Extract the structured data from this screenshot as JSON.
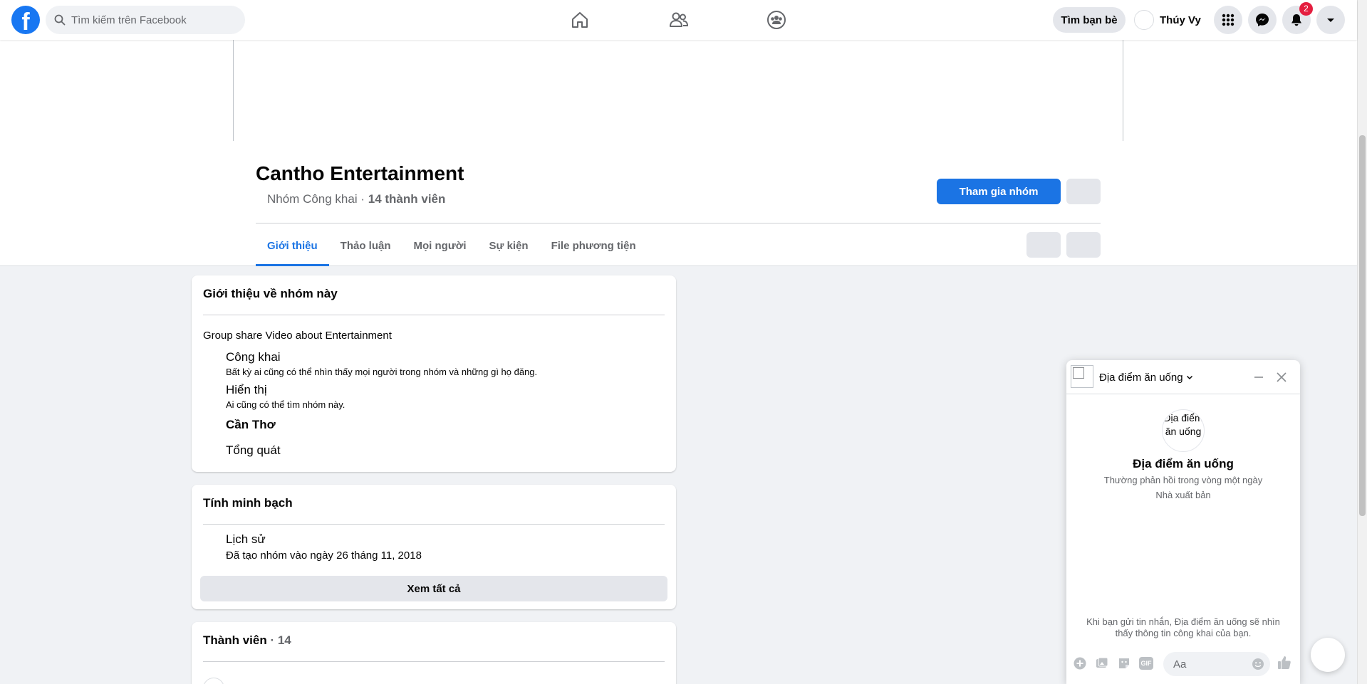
{
  "topbar": {
    "logo": "f",
    "search_placeholder": "Tìm kiếm trên Facebook",
    "find_friends_label": "Tìm bạn bè",
    "user_name": "Thúy Vy",
    "notification_count": "2"
  },
  "group": {
    "name": "Cantho Entertainment",
    "privacy_label": "Nhóm Công khai",
    "separator": " · ",
    "members_label": "14 thành viên",
    "join_label": "Tham gia nhóm"
  },
  "tabs": [
    "Giới thiệu",
    "Thảo luận",
    "Mọi người",
    "Sự kiện",
    "File phương tiện"
  ],
  "about": {
    "title": "Giới thiệu về nhóm này",
    "description": "Group share Video about Entertainment",
    "public_title": "Công khai",
    "public_desc": "Bất kỳ ai cũng có thể nhìn thấy mọi người trong nhóm và những gì họ đăng.",
    "visible_title": "Hiển thị",
    "visible_desc": "Ai cũng có thể tìm nhóm này.",
    "location": "Cần Thơ",
    "category": "Tổng quát"
  },
  "transparency": {
    "title": "Tính minh bạch",
    "history_title": "Lịch sử",
    "history_desc": "Đã tạo nhóm vào ngày 26 tháng 11, 2018",
    "see_all_label": "Xem tất cả"
  },
  "members": {
    "title": "Thành viên",
    "separator": " · ",
    "count": "14"
  },
  "chat": {
    "header_name": "Địa điểm ăn uống",
    "avatar_alt": "Địa điểm ăn uống",
    "name": "Địa điểm ăn uống",
    "response_time": "Thường phản hồi trong vòng một ngày",
    "role": "Nhà xuất bản",
    "privacy_note": "Khi bạn gửi tin nhắn, Địa điểm ăn uống sẽ nhìn thấy thông tin công khai của bạn.",
    "input_placeholder": "Aa",
    "gif_label": "GIF"
  },
  "colors": {
    "accent": "#1b74e4",
    "badge": "#e41e3f"
  }
}
